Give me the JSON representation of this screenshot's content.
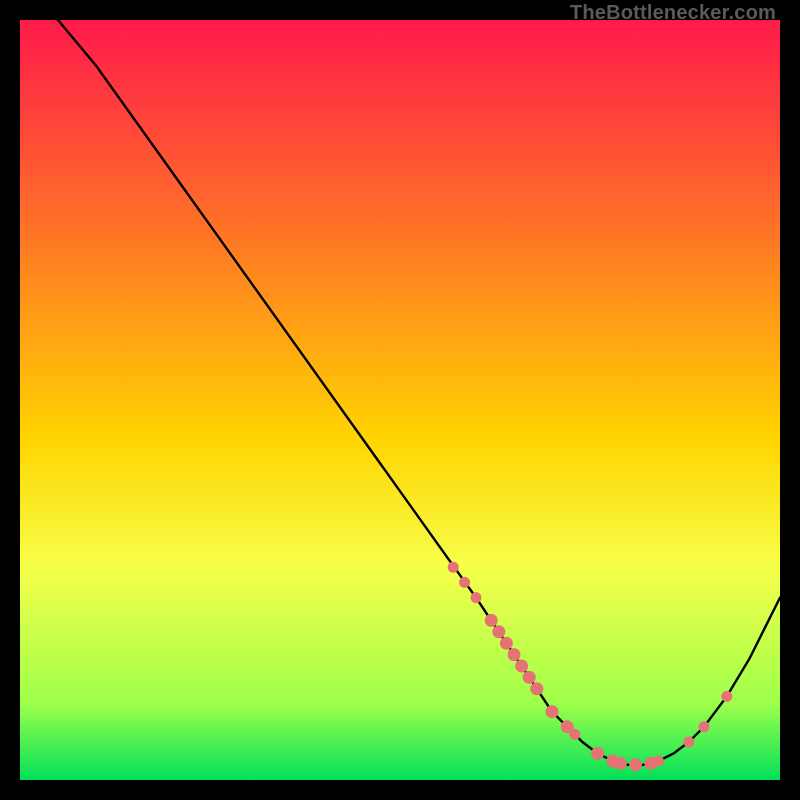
{
  "watermark": {
    "text": "TheBottlenecker.com"
  },
  "colors": {
    "top": "#ff1a4b",
    "mid": "#ffd400",
    "bottom": "#00e05a",
    "curve_stroke": "#000000",
    "dot_fill": "#e57373",
    "dot_stroke": "#e57373"
  },
  "gradient_css": "linear-gradient(to bottom, #ff1a4b 0%, #ff6a2a 25%, #ffd400 55%, #f6ff4a 72%, #9dff4a 90%, #00e05a 100%)",
  "chart_data": {
    "type": "line",
    "title": "",
    "xlabel": "",
    "ylabel": "",
    "xlim": [
      0,
      100
    ],
    "ylim": [
      0,
      100
    ],
    "grid": false,
    "legend": false,
    "series": [
      {
        "name": "bottleneck-curve",
        "x": [
          5,
          10,
          15,
          20,
          25,
          30,
          35,
          40,
          45,
          50,
          55,
          60,
          62,
          64,
          66,
          68,
          70,
          72,
          74,
          76,
          78,
          80,
          82,
          84,
          86,
          88,
          90,
          93,
          96,
          100
        ],
        "y": [
          100,
          94,
          87,
          80,
          73,
          66,
          59,
          52,
          45,
          38,
          31,
          24,
          21,
          18,
          15,
          12,
          9,
          7,
          5,
          3.5,
          2.5,
          2,
          2,
          2.5,
          3.5,
          5,
          7,
          11,
          16,
          24
        ]
      }
    ],
    "dots": {
      "name": "highlight-points",
      "points": [
        {
          "x": 57,
          "y": 28,
          "r": 5
        },
        {
          "x": 58.5,
          "y": 26,
          "r": 5
        },
        {
          "x": 60,
          "y": 24,
          "r": 5
        },
        {
          "x": 62,
          "y": 21,
          "r": 6
        },
        {
          "x": 63,
          "y": 19.5,
          "r": 6
        },
        {
          "x": 64,
          "y": 18,
          "r": 6
        },
        {
          "x": 65,
          "y": 16.5,
          "r": 6
        },
        {
          "x": 66,
          "y": 15,
          "r": 6
        },
        {
          "x": 67,
          "y": 13.5,
          "r": 6
        },
        {
          "x": 68,
          "y": 12,
          "r": 6
        },
        {
          "x": 70,
          "y": 9,
          "r": 6
        },
        {
          "x": 72,
          "y": 7,
          "r": 6
        },
        {
          "x": 73,
          "y": 6,
          "r": 5
        },
        {
          "x": 76,
          "y": 3.5,
          "r": 6
        },
        {
          "x": 78,
          "y": 2.5,
          "r": 6
        },
        {
          "x": 79,
          "y": 2.2,
          "r": 6
        },
        {
          "x": 81,
          "y": 2,
          "r": 6
        },
        {
          "x": 83,
          "y": 2.2,
          "r": 6
        },
        {
          "x": 84,
          "y": 2.5,
          "r": 5
        },
        {
          "x": 88,
          "y": 5,
          "r": 5
        },
        {
          "x": 90,
          "y": 7,
          "r": 5
        },
        {
          "x": 93,
          "y": 11,
          "r": 5
        }
      ]
    }
  }
}
